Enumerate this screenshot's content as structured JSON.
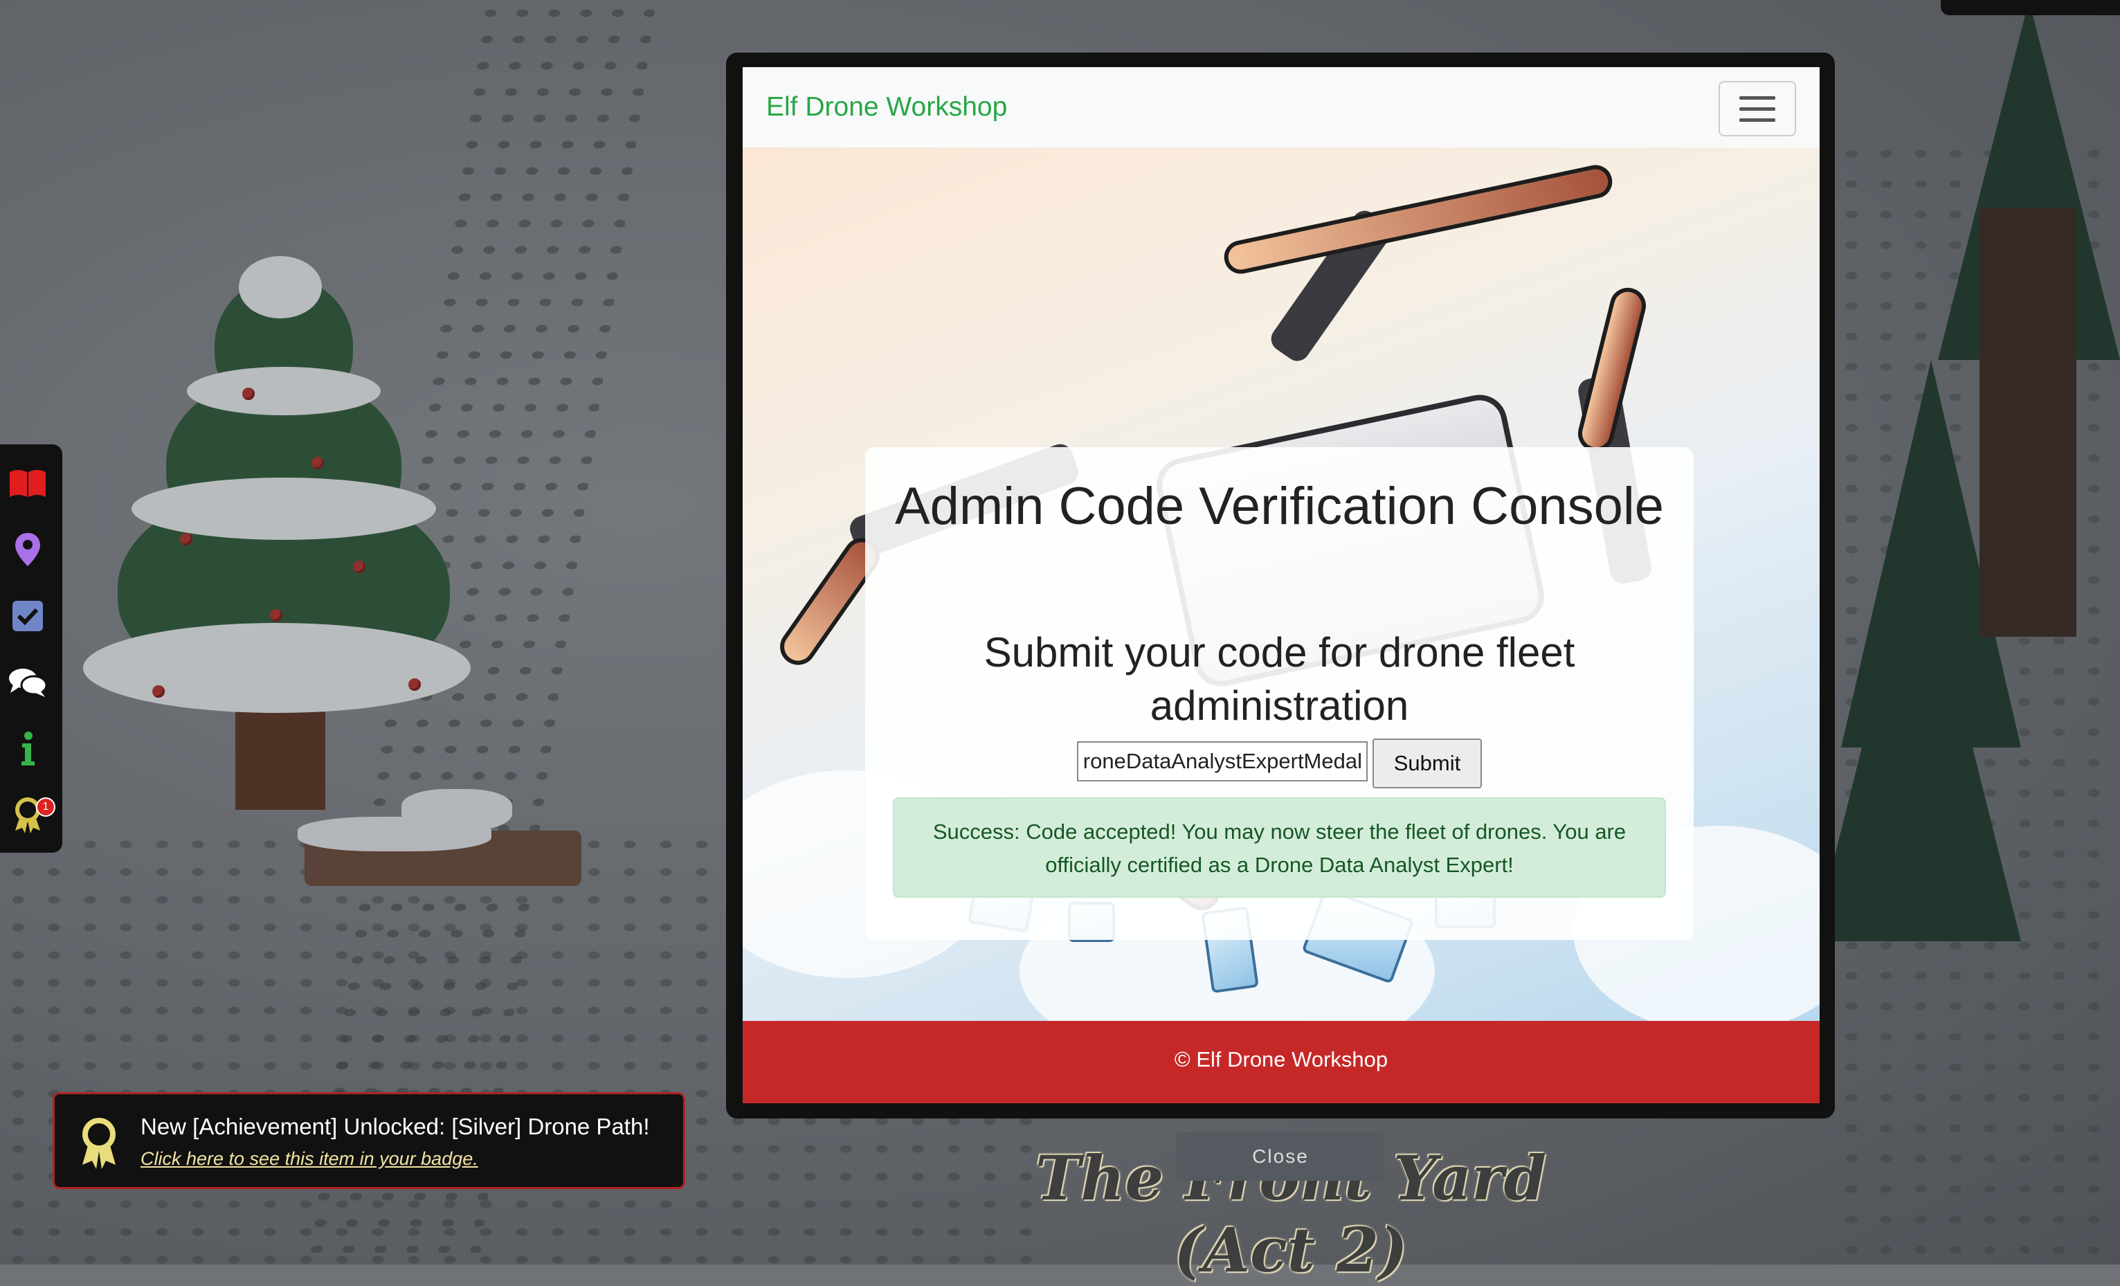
{
  "modal": {
    "brand": "Elf Drone Workshop",
    "menu_toggle_icon": "hamburger-icon",
    "heading": "Admin Code Verification Console",
    "subheading": "Submit your code for drone fleet administration",
    "code_input_value": "roneDataAnalystExpertMedal",
    "submit_label": "Submit",
    "alert_text": "Success: Code accepted! You may now steer the fleet of drones. You are officially certified as a Drone Data Analyst Expert!",
    "footer_text": "© Elf Drone Workshop"
  },
  "close_label": "Close",
  "area_title": "The Front Yard (Act 2)",
  "sidebar": {
    "items": [
      {
        "icon": "book-icon"
      },
      {
        "icon": "map-pin-icon"
      },
      {
        "icon": "objectives-checkbox-icon"
      },
      {
        "icon": "chat-icon"
      },
      {
        "icon": "info-icon"
      },
      {
        "icon": "achievements-icon",
        "badge": "1"
      }
    ]
  },
  "toast": {
    "title": "New [Achievement] Unlocked: [Silver] Drone Path!",
    "link": "Click here to see this item in your badge.",
    "icon": "achievement-ribbon-icon"
  },
  "colors": {
    "brand_green": "#28a745",
    "footer_red": "#c62828",
    "alert_bg": "#d4edda",
    "alert_text": "#155724",
    "toast_border": "#b32222"
  }
}
